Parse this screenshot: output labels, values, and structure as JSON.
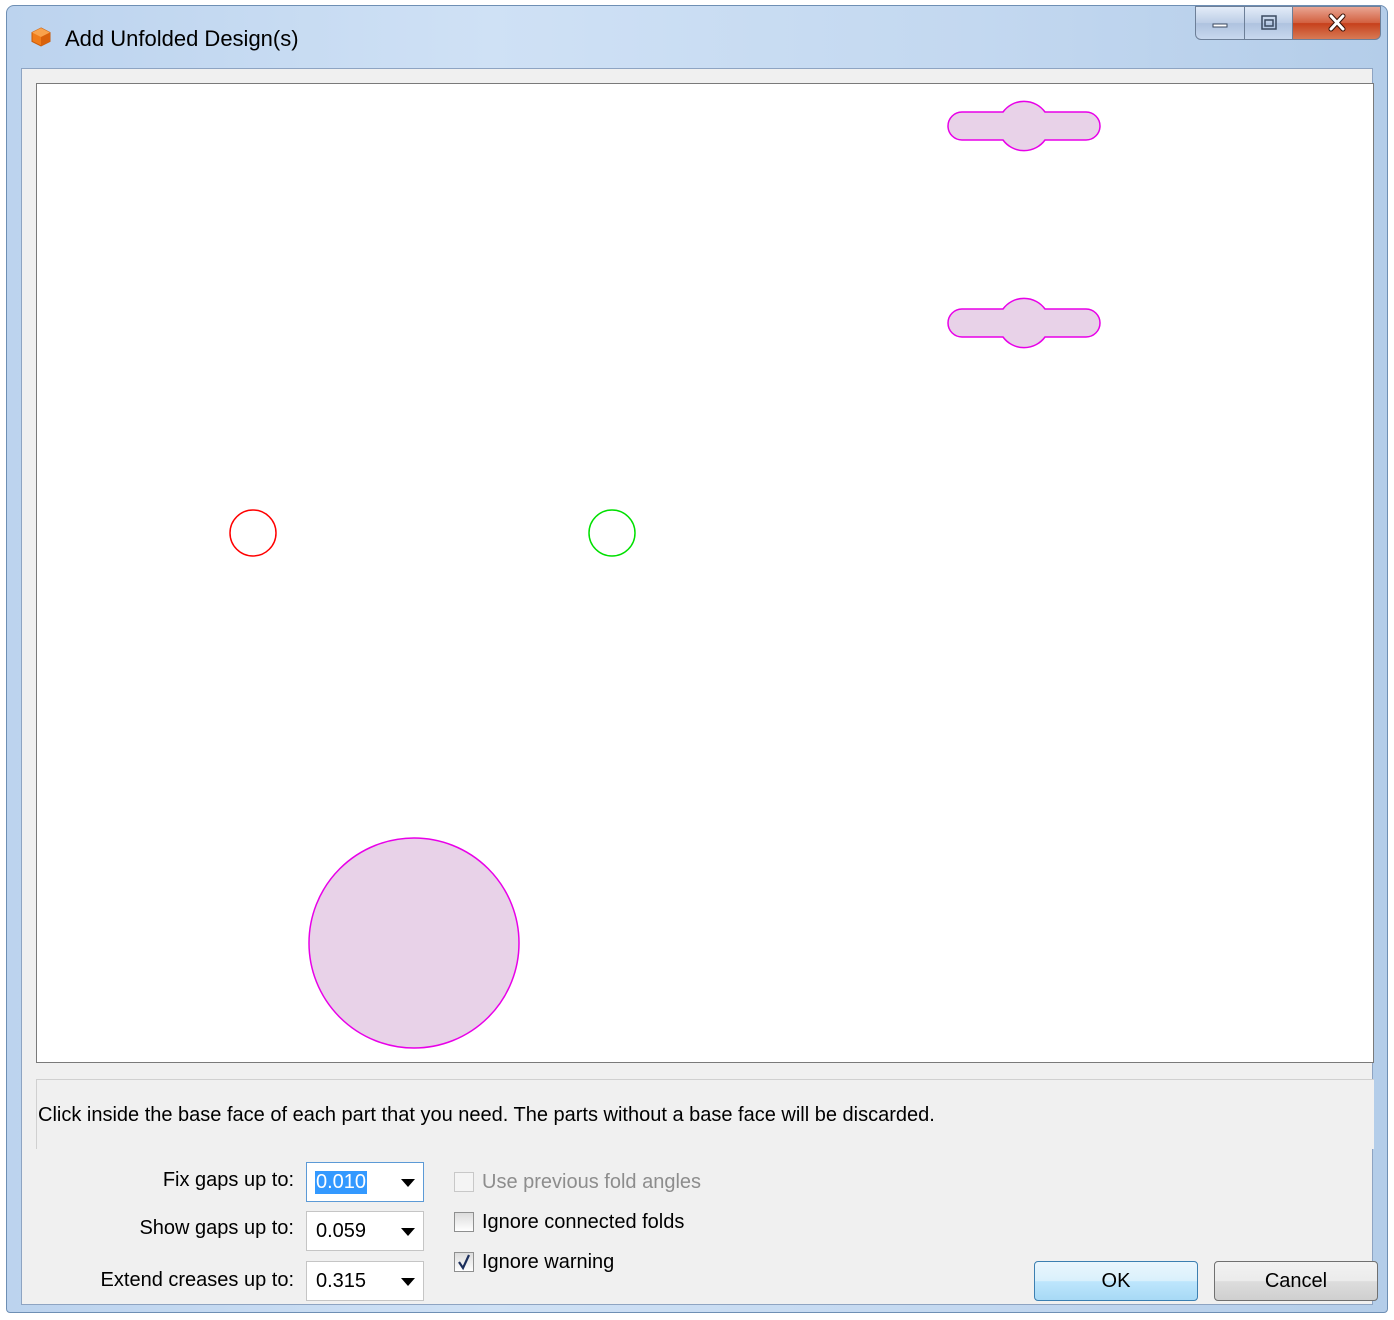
{
  "window": {
    "title": "Add Unfolded Design(s)",
    "icon": "orange-cube-icon"
  },
  "caption_buttons": {
    "minimize_icon": "minimize-icon",
    "maximize_icon": "maximize-icon",
    "close_icon": "close-icon"
  },
  "canvas": {
    "shapes": [
      {
        "name": "tab-shape-top",
        "type": "tab",
        "stroke": "#e800e8",
        "fill": "#e8d2e8"
      },
      {
        "name": "tab-shape-middle",
        "type": "tab",
        "stroke": "#e800e8",
        "fill": "#e8d2e8"
      },
      {
        "name": "circle-red",
        "type": "circle",
        "stroke": "#ff0000",
        "fill": "none"
      },
      {
        "name": "circle-green",
        "type": "circle",
        "stroke": "#00e000",
        "fill": "none"
      },
      {
        "name": "circle-large",
        "type": "circle",
        "stroke": "#e800e8",
        "fill": "#e8d2e8"
      }
    ]
  },
  "message": "Click inside the base face of each part that you need. The parts without a base face will be discarded.",
  "options": {
    "fix_gaps": {
      "label": "Fix gaps up to:",
      "value": "0.010"
    },
    "show_gaps": {
      "label": "Show gaps up to:",
      "value": "0.059"
    },
    "extend_creases": {
      "label": "Extend creases up to:",
      "value": "0.315"
    }
  },
  "checkboxes": {
    "use_previous_fold_angles": {
      "label": "Use previous fold angles",
      "checked": false,
      "enabled": false
    },
    "ignore_connected_folds": {
      "label": "Ignore connected folds",
      "checked": false,
      "enabled": true
    },
    "ignore_warning": {
      "label": "Ignore warning",
      "checked": true,
      "enabled": true
    }
  },
  "buttons": {
    "ok": "OK",
    "cancel": "Cancel"
  }
}
